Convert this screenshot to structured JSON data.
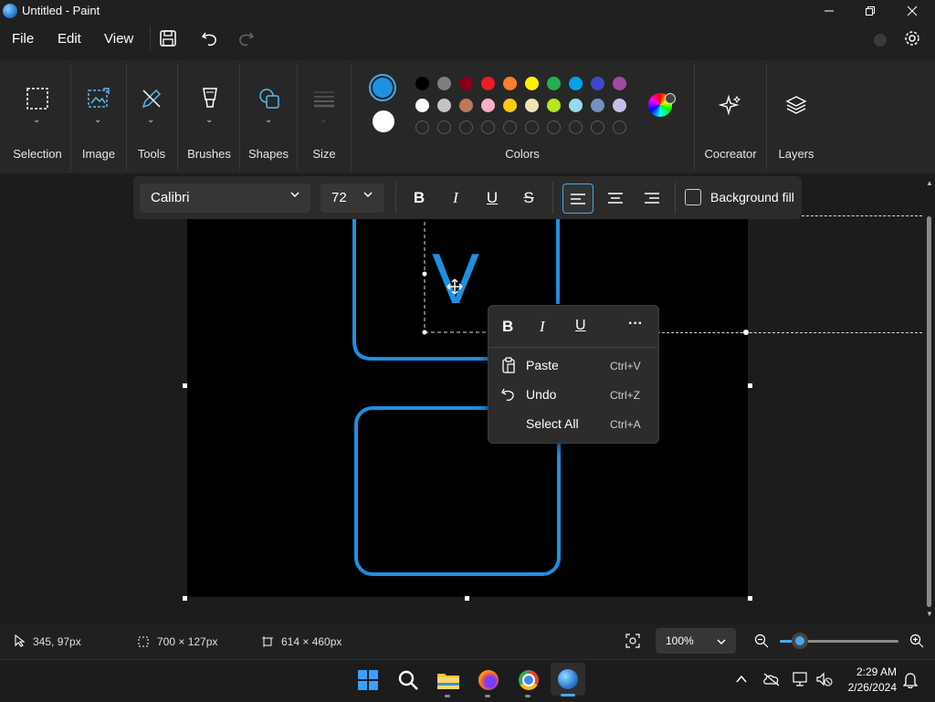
{
  "window": {
    "title": "Untitled - Paint",
    "min_icon": "minimize-icon",
    "max_icon": "maximize-icon",
    "close_icon": "close-icon"
  },
  "menu": {
    "file": "File",
    "edit": "Edit",
    "view": "View"
  },
  "ribbon": {
    "selection": "Selection",
    "image": "Image",
    "tools": "Tools",
    "brushes": "Brushes",
    "shapes": "Shapes",
    "size": "Size",
    "colors": "Colors",
    "cocreator": "Cocreator",
    "layers": "Layers",
    "primary_color": "#1e90e0",
    "secondary_color": "#ffffff",
    "palette_row1": [
      "#000000",
      "#7f7f7f",
      "#880015",
      "#ed1c24",
      "#ff7f27",
      "#fff200",
      "#22b14c",
      "#00a2e8",
      "#3f48cc",
      "#a349a4"
    ],
    "palette_row2": [
      "#ffffff",
      "#c3c3c3",
      "#b97a57",
      "#ffaec9",
      "#ffc90e",
      "#efe4b0",
      "#b5e61d",
      "#99d9ea",
      "#7092be",
      "#c8bfe7"
    ]
  },
  "text_toolbar": {
    "font": "Calibri",
    "size": "72",
    "background_fill": "Background fill"
  },
  "canvas_text": "V",
  "context_menu": {
    "items": [
      {
        "label": "Paste",
        "shortcut": "Ctrl+V"
      },
      {
        "label": "Undo",
        "shortcut": "Ctrl+Z"
      },
      {
        "label": "Select All",
        "shortcut": "Ctrl+A"
      }
    ]
  },
  "status": {
    "cursor": "345, 97px",
    "selection": "700 × 127px",
    "canvas": "614 × 460px",
    "zoom": "100%"
  },
  "taskbar": {
    "time": "2:29 AM",
    "date": "2/26/2024"
  }
}
